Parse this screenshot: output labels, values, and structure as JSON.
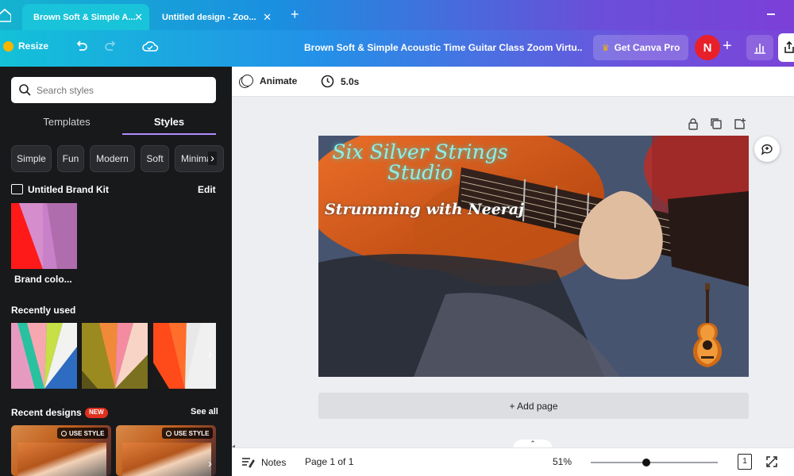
{
  "browser": {
    "tabs": [
      {
        "title": "Brown Soft & Simple A...",
        "active": true
      },
      {
        "title": "Untitled design - Zoo...",
        "active": false
      }
    ]
  },
  "toolbar": {
    "resize_label": "Resize",
    "document_title": "Brown Soft & Simple Acoustic Time Guitar Class Zoom Virtu...",
    "get_pro_label": "Get Canva Pro",
    "avatar_initial": "N"
  },
  "sidepanel": {
    "search_placeholder": "Search styles",
    "tabs": [
      "Templates",
      "Styles"
    ],
    "active_tab": "Styles",
    "style_chips": [
      "Simple",
      "Fun",
      "Modern",
      "Soft",
      "Minima"
    ],
    "brand_kit_title": "Untitled Brand Kit",
    "edit_label": "Edit",
    "brand_colors_label": "Brand colo...",
    "recently_used_label": "Recently used",
    "recent_designs_label": "Recent designs",
    "new_badge": "NEW",
    "see_all_label": "See all",
    "use_style_label": "USE STYLE"
  },
  "editor": {
    "animate_label": "Animate",
    "duration_label": "5.0s",
    "design_title_line1": "Six Silver Strings",
    "design_title_line2": "Studio",
    "design_subtitle": "Strumming with Neeraj",
    "add_page_label": "+ Add page",
    "notes_label": "Notes",
    "page_indicator": "Page 1 of 1",
    "zoom_label": "51%",
    "zoom_fraction": 0.51,
    "page_count": "1"
  },
  "colors": {
    "accent": "#8b3dff",
    "new_badge": "#e0301e",
    "avatar": "#e8202a"
  }
}
